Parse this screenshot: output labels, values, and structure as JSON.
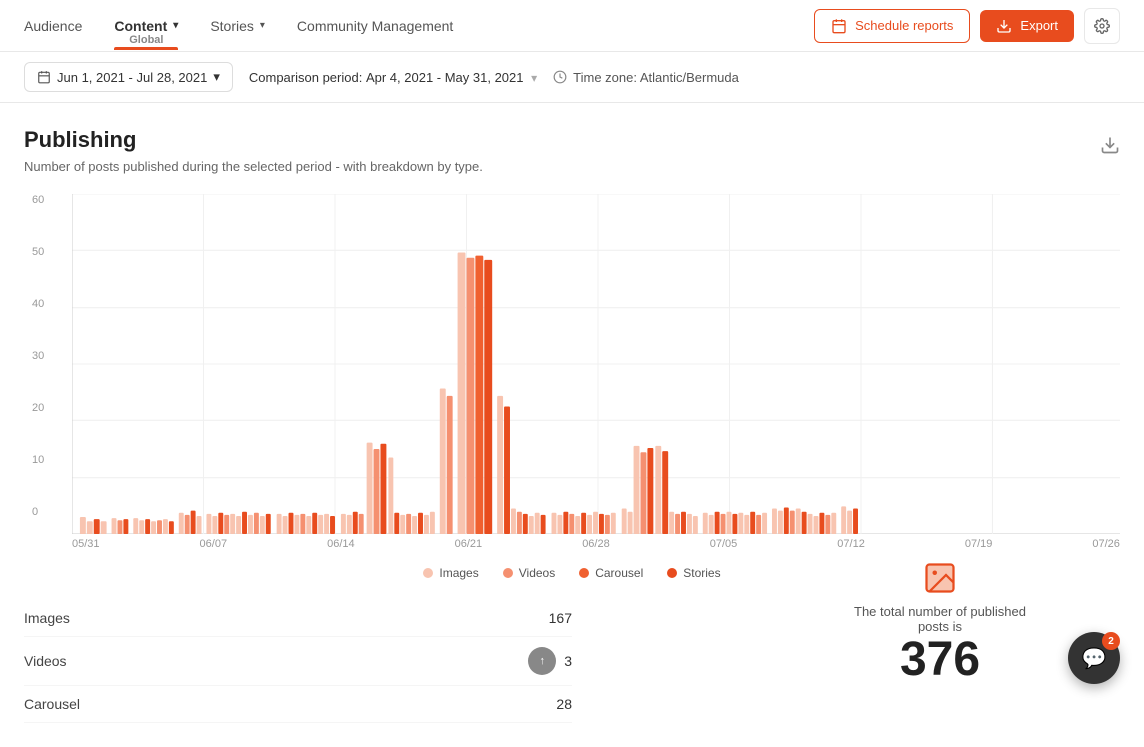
{
  "nav": {
    "items": [
      {
        "label": "Audience",
        "active": false,
        "hasDropdown": false
      },
      {
        "label": "Content",
        "active": true,
        "hasDropdown": true,
        "subtitle": "Global"
      },
      {
        "label": "Stories",
        "active": false,
        "hasDropdown": true
      },
      {
        "label": "Community Management",
        "active": false,
        "hasDropdown": false
      }
    ],
    "schedule_label": "Schedule reports",
    "export_label": "Export"
  },
  "filters": {
    "date_range": "Jun 1, 2021 - Jul 28, 2021",
    "comparison_label": "Comparison period:",
    "comparison_range": "Apr 4, 2021 - May 31, 2021",
    "timezone_label": "Time zone: Atlantic/Bermuda"
  },
  "publishing": {
    "title": "Publishing",
    "description": "Number of posts published during the selected period - with breakdown by type.",
    "y_labels": [
      "60",
      "50",
      "40",
      "30",
      "20",
      "10",
      "0"
    ],
    "x_labels": [
      "05/31",
      "06/07",
      "06/14",
      "06/21",
      "06/28",
      "07/05",
      "07/12",
      "07/19",
      "07/26"
    ],
    "legend": [
      {
        "label": "Images",
        "color": "#f8c4b0"
      },
      {
        "label": "Videos",
        "color": "#f59070"
      },
      {
        "label": "Carousel",
        "color": "#f06030"
      },
      {
        "label": "Stories",
        "color": "#e84c1e"
      }
    ],
    "stats": [
      {
        "label": "Images",
        "value": "167"
      },
      {
        "label": "Videos",
        "value": "3"
      },
      {
        "label": "Carousel",
        "value": "28"
      }
    ],
    "total_text": "The total number of published posts is",
    "total_value": "376"
  },
  "chat": {
    "badge": "2"
  }
}
